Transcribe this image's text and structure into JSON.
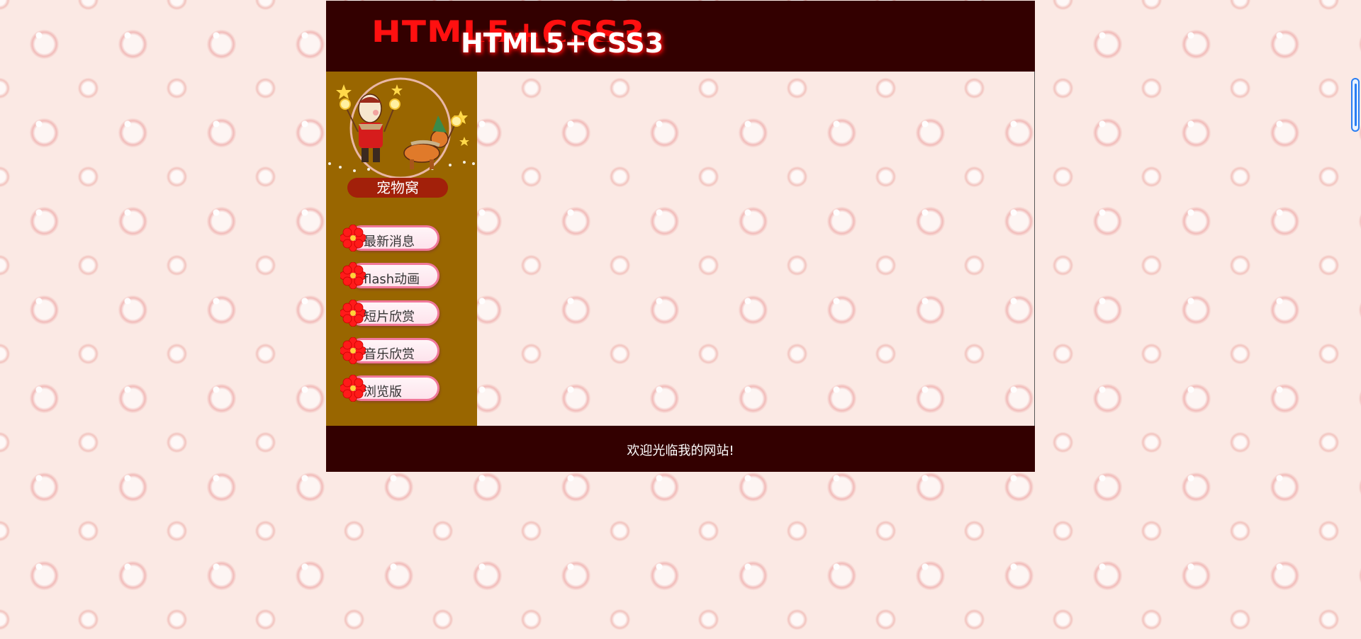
{
  "header": {
    "title_shadow": "HTML5+CSS3",
    "title": "HTML5+CSS3"
  },
  "sidebar": {
    "logo_text": "宠物窝",
    "items": [
      {
        "label": "最新消息",
        "icon": "flower-icon"
      },
      {
        "label": "flash动画",
        "icon": "flower-icon"
      },
      {
        "label": "短片欣赏",
        "icon": "flower-icon"
      },
      {
        "label": "音乐欣赏",
        "icon": "flower-icon"
      },
      {
        "label": "浏览版",
        "icon": "flower-icon"
      }
    ]
  },
  "footer": {
    "text": "欢迎光临我的网站!"
  },
  "colors": {
    "header_bg": "#330000",
    "sidebar_bg": "#996600",
    "page_bg": "#fbe9e4",
    "nav_border": "#f0789a",
    "accent_red": "#ff1010"
  }
}
